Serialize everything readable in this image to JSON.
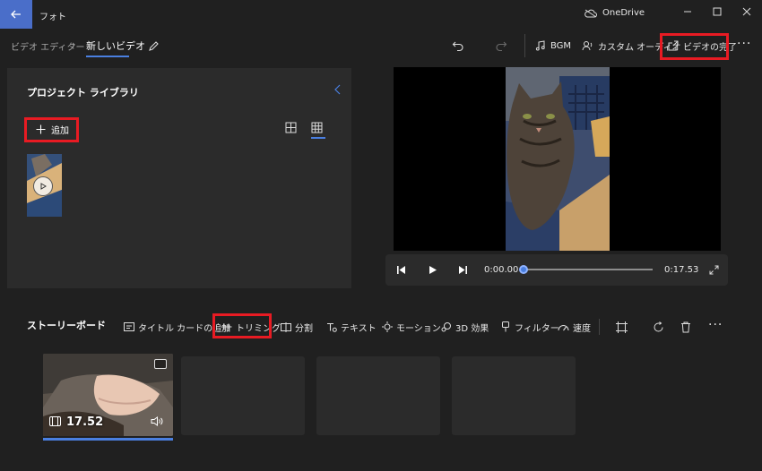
{
  "titlebar": {
    "app_title": "フォト",
    "onedrive_label": "OneDrive"
  },
  "breadcrumb": {
    "editor": "ビデオ エディター",
    "separator": "›",
    "project": "新しいビデオ"
  },
  "toolbar": {
    "bgm_label": "BGM",
    "custom_audio_label": "カスタム オーディオ",
    "finish_label": "ビデオの完了"
  },
  "library": {
    "title": "プロジェクト ライブラリ",
    "add_label": "追加"
  },
  "player": {
    "current_time": "0:00.00",
    "total_time": "0:17.53",
    "progress": 0
  },
  "storyboard": {
    "title": "ストーリーボード",
    "tools": {
      "title_card": "タイトル カードの追加",
      "trim": "トリミング",
      "split": "分割",
      "text": "テキスト",
      "motion": "モーション",
      "effects3d": "3D 効果",
      "filters": "フィルター",
      "speed": "速度"
    },
    "clips": [
      {
        "duration": "17.52"
      }
    ]
  },
  "colors": {
    "accent": "#4a7fe0",
    "highlight": "#e81b23",
    "panel": "#2b2b2b",
    "background": "#202020"
  }
}
